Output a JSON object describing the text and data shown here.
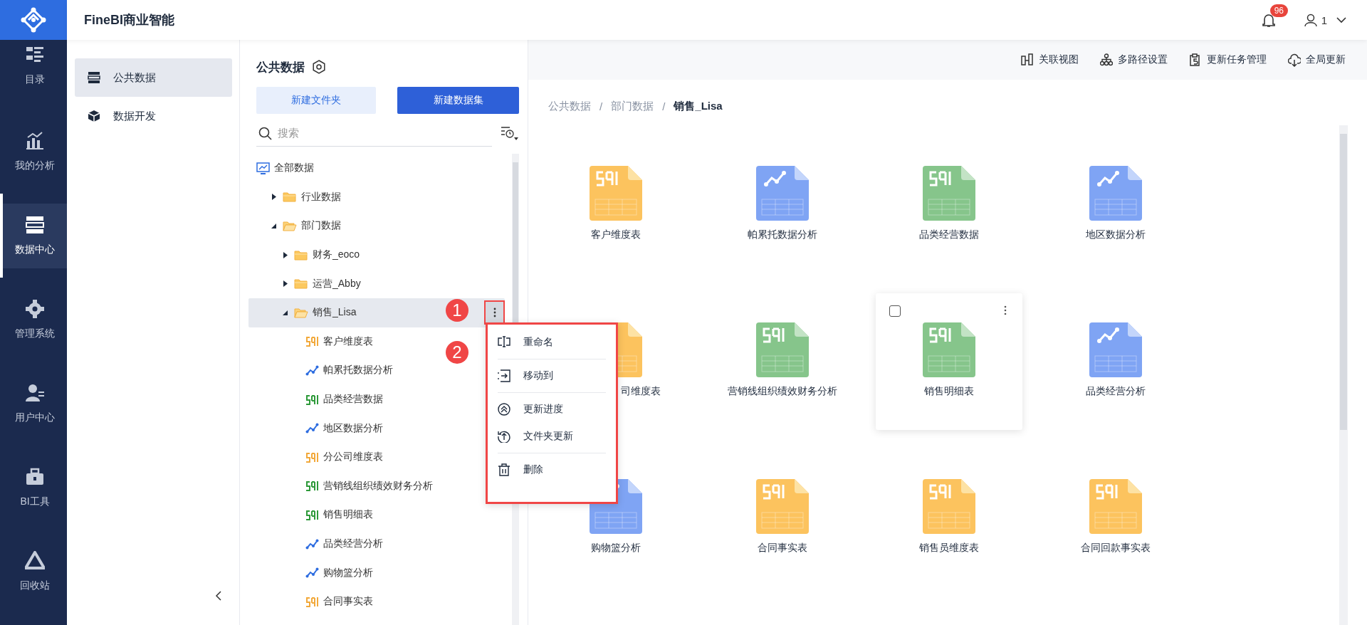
{
  "app": {
    "title": "FineBI商业智能"
  },
  "header": {
    "notification_count": "96",
    "user": "1"
  },
  "nav": [
    {
      "label": "目录",
      "selected": false
    },
    {
      "label": "我的分析",
      "selected": false
    },
    {
      "label": "数据中心",
      "selected": true
    },
    {
      "label": "管理系统",
      "selected": false
    },
    {
      "label": "用户中心",
      "selected": false
    },
    {
      "label": "BI工具",
      "selected": false
    },
    {
      "label": "回收站",
      "selected": false
    }
  ],
  "subnav": [
    {
      "label": "公共数据",
      "selected": true
    },
    {
      "label": "数据开发",
      "selected": false
    }
  ],
  "tree_panel": {
    "title": "公共数据",
    "buttons": [
      {
        "label": "新建文件夹",
        "kind": "secondary"
      },
      {
        "label": "新建数据集",
        "kind": "primary"
      }
    ],
    "search": {
      "placeholder": "搜索"
    },
    "tree": [
      {
        "label": "全部数据",
        "kind": "root",
        "selected": false,
        "children": [
          {
            "label": "行业数据",
            "kind": "folder",
            "expanded": false,
            "selected": false
          },
          {
            "label": "部门数据",
            "kind": "folder",
            "expanded": true,
            "selected": false,
            "children": [
              {
                "label": "财务_eoco",
                "kind": "folder",
                "expanded": false,
                "selected": false
              },
              {
                "label": "运营_Abby",
                "kind": "folder",
                "expanded": false,
                "selected": false
              },
              {
                "label": "销售_Lisa",
                "kind": "folder",
                "expanded": true,
                "selected": true,
                "children": [
                  {
                    "label": "客户维度表",
                    "kind": "sql",
                    "selected": false
                  },
                  {
                    "label": "帕累托数据分析",
                    "kind": "chart",
                    "selected": false
                  },
                  {
                    "label": "品类经营数据",
                    "kind": "xls",
                    "selected": false
                  },
                  {
                    "label": "地区数据分析",
                    "kind": "chart",
                    "selected": false
                  },
                  {
                    "label": "分公司维度表",
                    "kind": "sql",
                    "selected": false
                  },
                  {
                    "label": "营销线组织绩效财务分析",
                    "kind": "xls",
                    "selected": false
                  },
                  {
                    "label": "销售明细表",
                    "kind": "xls",
                    "selected": false
                  },
                  {
                    "label": "品类经营分析",
                    "kind": "chart",
                    "selected": false
                  },
                  {
                    "label": "购物篮分析",
                    "kind": "chart",
                    "selected": false
                  },
                  {
                    "label": "合同事实表",
                    "kind": "sql",
                    "selected": false
                  }
                ]
              }
            ]
          }
        ]
      }
    ]
  },
  "context_menu": {
    "groups": [
      {
        "items": [
          {
            "label": "重命名"
          }
        ]
      },
      {
        "items": [
          {
            "label": "移动到"
          }
        ]
      },
      {
        "items": [
          {
            "label": "更新进度"
          },
          {
            "label": "文件夹更新"
          }
        ]
      },
      {
        "items": [
          {
            "label": "删除"
          }
        ]
      }
    ]
  },
  "annotations": [
    {
      "label": "1"
    },
    {
      "label": "2"
    }
  ],
  "toolbar": [
    {
      "label": "关联视图"
    },
    {
      "label": "多路径设置"
    },
    {
      "label": "更新任务管理"
    },
    {
      "label": "全局更新"
    }
  ],
  "breadcrumb": [
    {
      "label": "公共数据",
      "kind": "link"
    },
    {
      "label": "/",
      "kind": "separator"
    },
    {
      "label": "部门数据",
      "kind": "link"
    },
    {
      "label": "/",
      "kind": "separator"
    },
    {
      "label": "销售_Lisa",
      "kind": "current"
    }
  ],
  "grid": [
    {
      "label": "客户维度表",
      "kind": "sql",
      "hovered": false
    },
    {
      "label": "帕累托数据分析",
      "kind": "chart",
      "hovered": false
    },
    {
      "label": "品类经营数据",
      "kind": "xls",
      "hovered": false
    },
    {
      "label": "地区数据分析",
      "kind": "chart",
      "hovered": false
    },
    {
      "label": "司维度表",
      "kind": "sql",
      "hovered": false
    },
    {
      "label": "营销线组织绩效财务分析",
      "kind": "xls",
      "hovered": false
    },
    {
      "label": "销售明细表",
      "kind": "xls",
      "hovered": true,
      "checked": false
    },
    {
      "label": "品类经营分析",
      "kind": "chart",
      "hovered": false
    },
    {
      "label": "购物篮分析",
      "kind": "chart",
      "hovered": false
    },
    {
      "label": "合同事实表",
      "kind": "sql",
      "hovered": false
    },
    {
      "label": "销售员维度表",
      "kind": "sql",
      "hovered": false
    },
    {
      "label": "合同回款事实表",
      "kind": "sql",
      "hovered": false
    }
  ]
}
